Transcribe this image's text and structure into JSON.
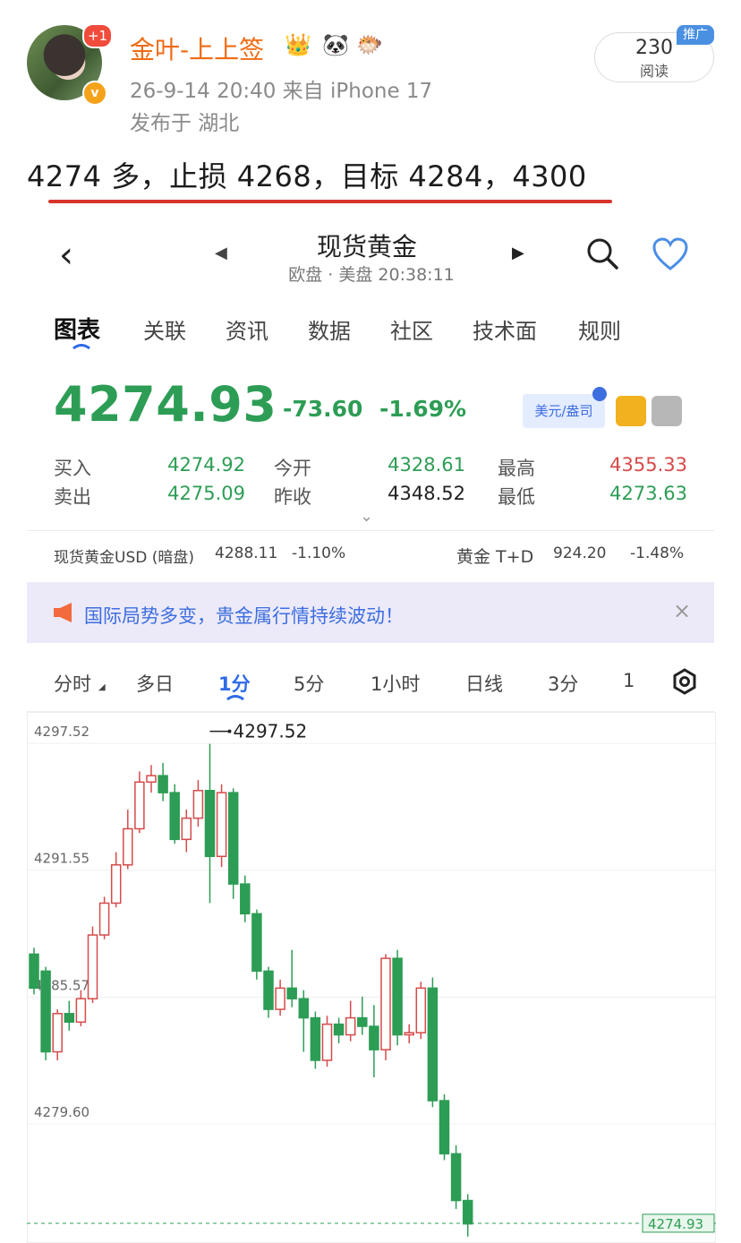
{
  "post": {
    "username": "金叶-上上签",
    "badge_plus": "+1",
    "badge_v": "v",
    "emoji": [
      "👑",
      "🐼",
      "🐡"
    ],
    "meta": "26-9-14 20:40  来自 iPhone 17",
    "location": "发布于 湖北",
    "reads_count": "230",
    "reads_label": "阅读",
    "promo_label": "推广",
    "text": "4274 多，止损 4268，目标 4284，4300"
  },
  "app": {
    "title": "现货黄金",
    "subtitle": "欧盘 · 美盘 20:38:11",
    "tabs": [
      "图表",
      "关联",
      "资讯",
      "数据",
      "社区",
      "技术面",
      "规则"
    ],
    "price": "4274.93",
    "change": "-73.60",
    "change_pct": "-1.69%",
    "unit": "美元/盎司",
    "quote": {
      "buy_label": "买入",
      "buy": "4274.92",
      "sell_label": "卖出",
      "sell": "4275.09",
      "open_label": "今开",
      "open": "4328.61",
      "prev_close_label": "昨收",
      "prev_close": "4348.52",
      "high_label": "最高",
      "high": "4355.33",
      "low_label": "最低",
      "low": "4273.63"
    },
    "related": {
      "usd_label": "现货黄金USD (暗盘)",
      "usd_value": "4288.11",
      "usd_change": "-1.10%",
      "td_label": "黄金 T+D",
      "td_value": "924.20",
      "td_change": "-1.48%"
    },
    "notice": "国际局势多变，贵金属行情持续波动！",
    "notice_close": "×",
    "periods": [
      "分时",
      "多日",
      "1分",
      "5分",
      "1小时",
      "日线",
      "3分",
      "1"
    ],
    "colors": {
      "up": "#d64a4a",
      "down": "#2d9d55",
      "accent": "#2f6ae8"
    }
  },
  "chart_data": {
    "type": "candlestick",
    "y_ticks": [
      "4297.52",
      "4291.55",
      "4285.57",
      "4279.60"
    ],
    "ylim": [
      4274.0,
      4299.0
    ],
    "max_label": "4297.52",
    "last_label": "4274.93",
    "candles": [
      {
        "o": 4287.6,
        "c": 4286.0,
        "h": 4287.9,
        "l": 4285.7
      },
      {
        "o": 4286.8,
        "c": 4283.0,
        "h": 4287.0,
        "l": 4282.6
      },
      {
        "o": 4283.0,
        "c": 4284.8,
        "h": 4285.0,
        "l": 4282.6
      },
      {
        "o": 4284.8,
        "c": 4284.4,
        "h": 4285.4,
        "l": 4284.0
      },
      {
        "o": 4284.4,
        "c": 4285.5,
        "h": 4285.9,
        "l": 4284.2
      },
      {
        "o": 4285.5,
        "c": 4288.5,
        "h": 4288.9,
        "l": 4285.3
      },
      {
        "o": 4288.5,
        "c": 4290.0,
        "h": 4290.3,
        "l": 4288.3
      },
      {
        "o": 4290.0,
        "c": 4291.8,
        "h": 4292.4,
        "l": 4289.8
      },
      {
        "o": 4291.8,
        "c": 4293.5,
        "h": 4294.4,
        "l": 4291.6
      },
      {
        "o": 4293.5,
        "c": 4295.7,
        "h": 4296.2,
        "l": 4293.3
      },
      {
        "o": 4295.7,
        "c": 4296.0,
        "h": 4296.5,
        "l": 4295.2
      },
      {
        "o": 4296.0,
        "c": 4295.2,
        "h": 4296.6,
        "l": 4294.8
      },
      {
        "o": 4295.2,
        "c": 4293.0,
        "h": 4295.6,
        "l": 4292.8
      },
      {
        "o": 4293.0,
        "c": 4294.0,
        "h": 4294.4,
        "l": 4292.4
      },
      {
        "o": 4294.0,
        "c": 4295.3,
        "h": 4295.8,
        "l": 4293.6
      },
      {
        "o": 4295.3,
        "c": 4292.2,
        "h": 4297.5,
        "l": 4290.0
      },
      {
        "o": 4292.2,
        "c": 4295.2,
        "h": 4295.6,
        "l": 4291.7
      },
      {
        "o": 4295.2,
        "c": 4290.9,
        "h": 4295.4,
        "l": 4290.2
      },
      {
        "o": 4290.9,
        "c": 4289.5,
        "h": 4291.3,
        "l": 4289.1
      },
      {
        "o": 4289.5,
        "c": 4286.8,
        "h": 4289.7,
        "l": 4286.4
      },
      {
        "o": 4286.8,
        "c": 4285.0,
        "h": 4287.0,
        "l": 4284.6
      },
      {
        "o": 4285.0,
        "c": 4286.0,
        "h": 4286.4,
        "l": 4284.7
      },
      {
        "o": 4286.0,
        "c": 4285.5,
        "h": 4287.8,
        "l": 4285.1
      },
      {
        "o": 4285.5,
        "c": 4284.6,
        "h": 4285.9,
        "l": 4283.0
      },
      {
        "o": 4284.6,
        "c": 4282.6,
        "h": 4284.9,
        "l": 4282.2
      },
      {
        "o": 4282.6,
        "c": 4284.3,
        "h": 4284.7,
        "l": 4282.3
      },
      {
        "o": 4284.3,
        "c": 4283.8,
        "h": 4284.6,
        "l": 4283.4
      },
      {
        "o": 4283.8,
        "c": 4284.6,
        "h": 4285.4,
        "l": 4283.5
      },
      {
        "o": 4284.6,
        "c": 4284.2,
        "h": 4285.6,
        "l": 4283.8
      },
      {
        "o": 4284.2,
        "c": 4283.1,
        "h": 4285.2,
        "l": 4281.8
      },
      {
        "o": 4283.1,
        "c": 4287.4,
        "h": 4287.6,
        "l": 4282.6
      },
      {
        "o": 4287.4,
        "c": 4283.8,
        "h": 4287.8,
        "l": 4283.3
      },
      {
        "o": 4283.8,
        "c": 4283.9,
        "h": 4284.3,
        "l": 4283.4
      },
      {
        "o": 4283.9,
        "c": 4286.0,
        "h": 4286.3,
        "l": 4283.6
      },
      {
        "o": 4286.0,
        "c": 4280.7,
        "h": 4286.5,
        "l": 4280.4
      },
      {
        "o": 4280.7,
        "c": 4278.2,
        "h": 4281.0,
        "l": 4277.9
      },
      {
        "o": 4278.2,
        "c": 4276.0,
        "h": 4278.6,
        "l": 4275.6
      },
      {
        "o": 4276.0,
        "c": 4274.9,
        "h": 4276.3,
        "l": 4274.3
      }
    ]
  }
}
